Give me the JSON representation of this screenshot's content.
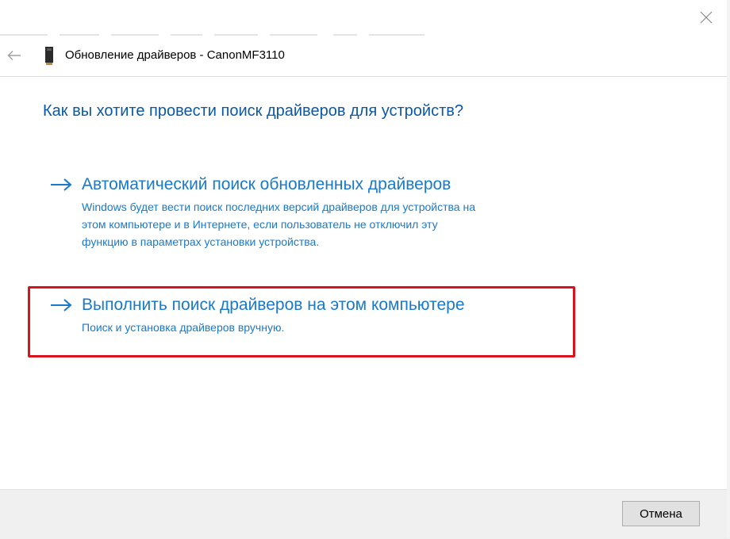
{
  "window": {
    "close_icon": "close-icon",
    "title": "Обновление драйверов - CanonMF3110",
    "back_icon": "back-arrow-icon",
    "device_icon": "device-icon"
  },
  "question": "Как вы хотите провести поиск драйверов для устройств?",
  "options": [
    {
      "icon": "arrow-right-icon",
      "title": "Автоматический поиск обновленных драйверов",
      "description_lines": [
        "Windows будет вести поиск последних версий драйверов для устройства на",
        "этом компьютере и в Интернете, если пользователь не отключил эту",
        "функцию в параметрах установки устройства."
      ]
    },
    {
      "icon": "arrow-right-icon",
      "title": "Выполнить поиск драйверов на этом компьютере",
      "description_lines": [
        "Поиск и установка драйверов вручную."
      ],
      "highlighted": true
    }
  ],
  "footer": {
    "cancel_label": "Отмена"
  },
  "colors": {
    "question_text": "#0b58a6",
    "link_text": "#1979ca",
    "highlight_border": "#d7131d",
    "footer_bg": "#f0f0f0"
  }
}
